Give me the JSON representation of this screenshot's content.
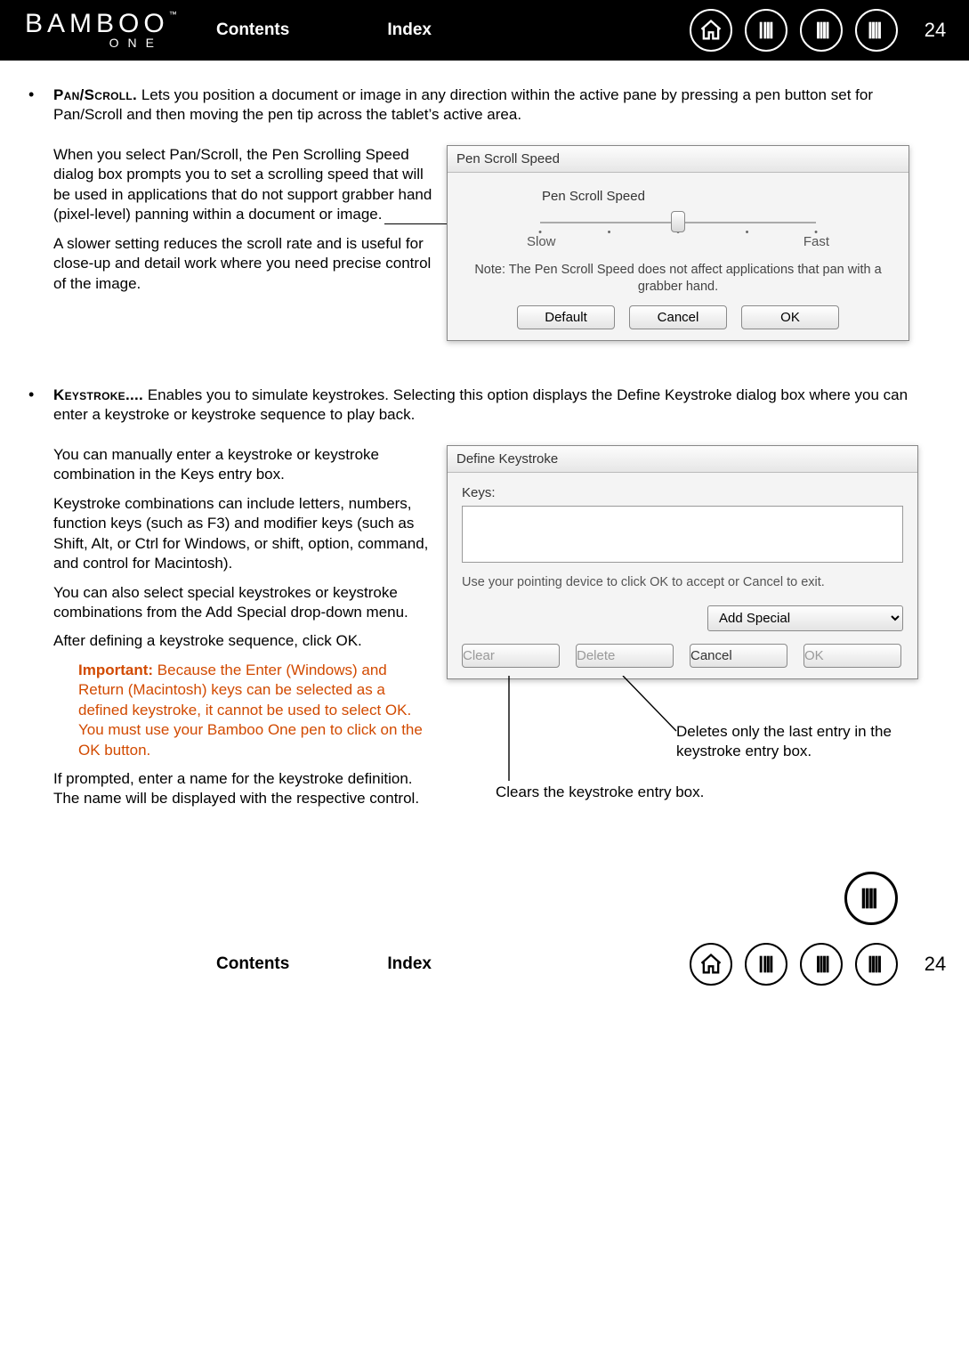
{
  "brand": {
    "name": "BAMBOO",
    "tm": "™",
    "sub": "ONE"
  },
  "nav": {
    "contents": "Contents",
    "index": "Index",
    "page": "24",
    "icons": {
      "home": "home-icon",
      "first": "first-page-icon",
      "prev": "previous-page-icon",
      "next": "next-page-icon"
    }
  },
  "section1": {
    "heading": "Pan/Scroll.",
    "lead_rest": "  Lets you position a document or image in any direction within the active pane by pressing a pen button set for Pan/Scroll and then moving the pen tip across the tablet’s active area.",
    "p1": "When you select Pan/Scroll, the Pen Scrolling Speed dialog box prompts you to set a scrolling speed that will be used in applications that do not support grabber hand (pixel-level) panning within a document or image.",
    "p2": "A slower setting reduces the scroll rate and is useful for close-up and detail work where you need precise control of the image."
  },
  "pss_dialog": {
    "title": "Pen Scroll Speed",
    "label": "Pen Scroll Speed",
    "slow": "Slow",
    "fast": "Fast",
    "note": "Note: The Pen Scroll Speed does not affect applications that pan with a grabber hand.",
    "buttons": {
      "default": "Default",
      "cancel": "Cancel",
      "ok": "OK"
    },
    "slider": {
      "min": 0,
      "max": 4,
      "value": 2,
      "ticks": 5
    }
  },
  "section2": {
    "heading": "Keystroke....",
    "lead_rest": "  Enables you to simulate keystrokes.  Selecting this option displays the Define Keystroke dialog box where you can enter a keystroke or keystroke sequence to play back.",
    "p1": "You can manually enter a keystroke or keystroke combination in the Keys entry box.",
    "p2": "Keystroke combinations can include letters, numbers, function keys (such as F3) and modifier keys (such as Shift, Alt, or Ctrl for Windows, or shift, option, command, and control for Macintosh).",
    "p3": "You can also select special keystrokes or keystroke combinations from the Add Special drop-down menu.",
    "p4": "After defining a keystroke sequence, click OK.",
    "important_label": "Important:",
    "important": " Because the Enter (Windows) and Return (Macintosh) keys can be selected as a defined keystroke, it cannot be used to select OK. You must use your Bamboo One pen to click on the OK button.",
    "p5": "If prompted, enter a name for the keystroke definition.  The name will be displayed with the respective control."
  },
  "dk_dialog": {
    "title": "Define Keystroke",
    "keys_label": "Keys:",
    "hint": "Use your pointing device to click OK to accept or Cancel to exit.",
    "add_special": "Add Special",
    "buttons": {
      "clear": "Clear",
      "delete": "Delete",
      "cancel": "Cancel",
      "ok": "OK"
    }
  },
  "callouts": {
    "clear": "Clears the keystroke entry box.",
    "delete": "Deletes only the last entry in the keystroke entry box."
  }
}
